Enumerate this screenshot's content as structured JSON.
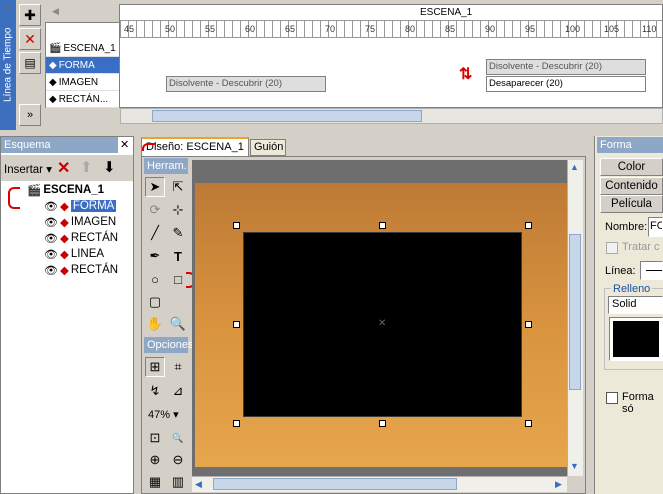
{
  "timeline": {
    "vertical_label": "Línea de Tiempo",
    "scene_title": "ESCENA_1",
    "ruler": [
      "45",
      "50",
      "55",
      "60",
      "65",
      "70",
      "75",
      "80",
      "85",
      "90",
      "95",
      "100",
      "105",
      "110"
    ],
    "layers": [
      "ESCENA_1",
      "FORMA",
      "IMAGEN",
      "RECTÁN..."
    ],
    "clips": {
      "left": "Disolvente - Descubrir (20)",
      "right_top": "Disolvente - Descubrir (20)",
      "right_bottom": "Desaparecer (20)"
    }
  },
  "outline": {
    "title": "Esquema",
    "insert_label": "Insertar",
    "root": "ESCENA_1",
    "items": [
      "FORMA",
      "IMAGEN",
      "RECTÁN",
      "LINEA",
      "RECTÁN"
    ]
  },
  "design": {
    "tab_active": "Diseño: ESCENA_1",
    "tab_other": "Guión",
    "tools_title": "Herram.",
    "options_title": "Opciones",
    "zoom": "47%"
  },
  "props": {
    "title": "Forma",
    "buttons": [
      "Color",
      "Contenido",
      "Película"
    ],
    "name_label": "Nombre:",
    "name_value": "FO",
    "treat_label": "Tratar c",
    "line_label": "Línea:",
    "fill_label": "Relleno",
    "fill_value": "Solid",
    "forma_label": "Forma só"
  }
}
